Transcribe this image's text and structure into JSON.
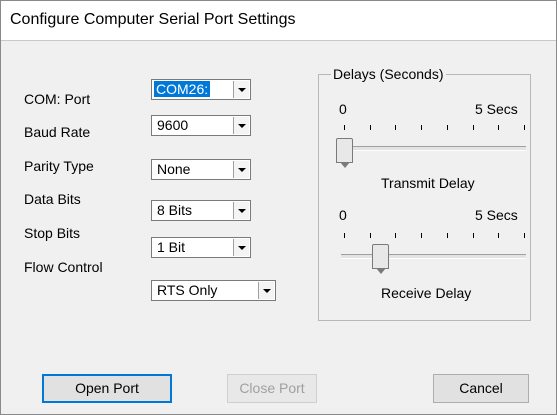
{
  "window": {
    "title": "Configure Computer Serial Port Settings"
  },
  "settings": [
    {
      "label": "COM: Port",
      "value": "COM26:",
      "selected": true
    },
    {
      "label": "Baud Rate",
      "value": "9600"
    },
    {
      "label": "Parity Type",
      "value": "None"
    },
    {
      "label": "Data Bits",
      "value": "8 Bits"
    },
    {
      "label": "Stop Bits",
      "value": "1 Bit"
    },
    {
      "label": "Flow Control",
      "value": "RTS Only"
    }
  ],
  "delays": {
    "title": "Delays (Seconds)",
    "transmit": {
      "min_label": "0",
      "max_label": "5 Secs",
      "caption": "Transmit Delay",
      "tick_count": 8,
      "level": 0.0
    },
    "receive": {
      "min_label": "0",
      "max_label": "5 Secs",
      "caption": "Receive Delay",
      "tick_count": 8,
      "level": 0.2
    }
  },
  "buttons": {
    "open": "Open Port",
    "close": "Close Port",
    "cancel": "Cancel"
  },
  "colors": {
    "accent": "#0078d7",
    "dialog_bg": "#f0f0f0"
  }
}
